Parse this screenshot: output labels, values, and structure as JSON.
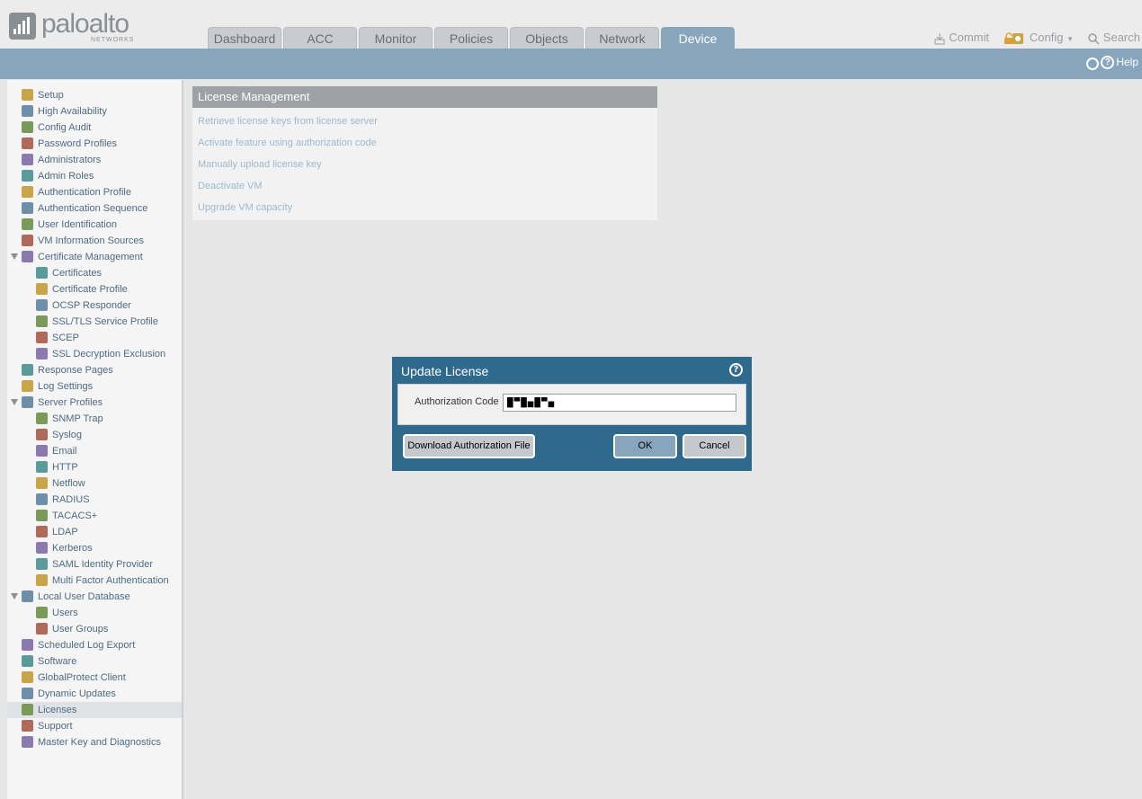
{
  "brand": {
    "name": "paloalto",
    "sub": "NETWORKS"
  },
  "tabs": [
    "Dashboard",
    "ACC",
    "Monitor",
    "Policies",
    "Objects",
    "Network",
    "Device"
  ],
  "active_tab": "Device",
  "toolbar": {
    "commit": "Commit",
    "config": "Config",
    "search": "Search",
    "help": "Help"
  },
  "sidebar": {
    "items": [
      {
        "label": "Setup",
        "level": 0,
        "icon": "setup-icon"
      },
      {
        "label": "High Availability",
        "level": 0,
        "icon": "high-availability-icon"
      },
      {
        "label": "Config Audit",
        "level": 0,
        "icon": "config-audit-icon"
      },
      {
        "label": "Password Profiles",
        "level": 0,
        "icon": "password-profiles-icon"
      },
      {
        "label": "Administrators",
        "level": 0,
        "icon": "administrators-icon"
      },
      {
        "label": "Admin Roles",
        "level": 0,
        "icon": "admin-roles-icon"
      },
      {
        "label": "Authentication Profile",
        "level": 0,
        "icon": "authentication-profile-icon"
      },
      {
        "label": "Authentication Sequence",
        "level": 0,
        "icon": "authentication-sequence-icon"
      },
      {
        "label": "User Identification",
        "level": 0,
        "icon": "user-identification-icon"
      },
      {
        "label": "VM Information Sources",
        "level": 0,
        "icon": "vm-information-icon"
      },
      {
        "label": "Certificate Management",
        "level": 0,
        "icon": "certificate-management-icon",
        "expanded": true
      },
      {
        "label": "Certificates",
        "level": 1,
        "icon": "certificates-icon"
      },
      {
        "label": "Certificate Profile",
        "level": 1,
        "icon": "certificate-profile-icon"
      },
      {
        "label": "OCSP Responder",
        "level": 1,
        "icon": "ocsp-responder-icon"
      },
      {
        "label": "SSL/TLS Service Profile",
        "level": 1,
        "icon": "lock-icon"
      },
      {
        "label": "SCEP",
        "level": 1,
        "icon": "scep-icon"
      },
      {
        "label": "SSL Decryption Exclusion",
        "level": 1,
        "icon": "lock-icon"
      },
      {
        "label": "Response Pages",
        "level": 0,
        "icon": "response-pages-icon"
      },
      {
        "label": "Log Settings",
        "level": 0,
        "icon": "log-settings-icon"
      },
      {
        "label": "Server Profiles",
        "level": 0,
        "icon": "server-profiles-icon",
        "expanded": true
      },
      {
        "label": "SNMP Trap",
        "level": 1,
        "icon": "snmp-trap-icon"
      },
      {
        "label": "Syslog",
        "level": 1,
        "icon": "syslog-icon"
      },
      {
        "label": "Email",
        "level": 1,
        "icon": "email-icon"
      },
      {
        "label": "HTTP",
        "level": 1,
        "icon": "http-icon"
      },
      {
        "label": "Netflow",
        "level": 1,
        "icon": "netflow-icon"
      },
      {
        "label": "RADIUS",
        "level": 1,
        "icon": "radius-icon"
      },
      {
        "label": "TACACS+",
        "level": 1,
        "icon": "tacacs-icon"
      },
      {
        "label": "LDAP",
        "level": 1,
        "icon": "ldap-icon"
      },
      {
        "label": "Kerberos",
        "level": 1,
        "icon": "kerberos-icon"
      },
      {
        "label": "SAML Identity Provider",
        "level": 1,
        "icon": "saml-icon"
      },
      {
        "label": "Multi Factor Authentication",
        "level": 1,
        "icon": "mfa-icon"
      },
      {
        "label": "Local User Database",
        "level": 0,
        "icon": "local-user-database-icon",
        "expanded": true
      },
      {
        "label": "Users",
        "level": 1,
        "icon": "user-icon"
      },
      {
        "label": "User Groups",
        "level": 1,
        "icon": "user-groups-icon"
      },
      {
        "label": "Scheduled Log Export",
        "level": 0,
        "icon": "scheduled-log-export-icon"
      },
      {
        "label": "Software",
        "level": 0,
        "icon": "software-icon"
      },
      {
        "label": "GlobalProtect Client",
        "level": 0,
        "icon": "globalprotect-icon"
      },
      {
        "label": "Dynamic Updates",
        "level": 0,
        "icon": "dynamic-updates-icon"
      },
      {
        "label": "Licenses",
        "level": 0,
        "icon": "key-icon",
        "selected": true
      },
      {
        "label": "Support",
        "level": 0,
        "icon": "support-icon"
      },
      {
        "label": "Master Key and Diagnostics",
        "level": 0,
        "icon": "lock-icon"
      }
    ]
  },
  "license_management": {
    "title": "License Management",
    "links": [
      "Retrieve license keys from license server",
      "Activate feature using authorization code",
      "Manually upload license key",
      "Deactivate VM",
      "Upgrade VM capacity"
    ]
  },
  "dialog": {
    "title": "Update License",
    "field_label": "Authorization Code",
    "field_value": "█▀█▄█▀▄",
    "download_label": "Download Authorization File",
    "ok_label": "OK",
    "cancel_label": "Cancel"
  },
  "colors": {
    "accent": "#87a6bd",
    "dialog_bg": "#2f6a8c",
    "link": "#9fb8cc",
    "nav_text": "#4e6a82"
  }
}
